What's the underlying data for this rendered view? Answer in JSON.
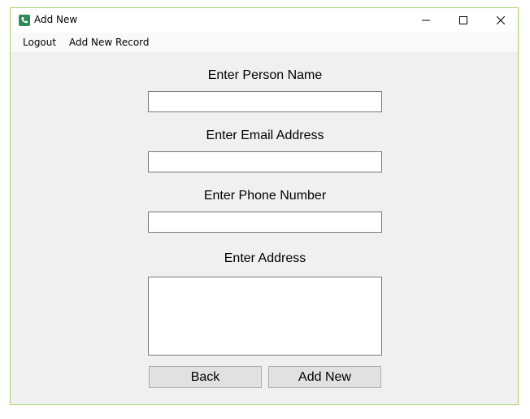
{
  "window": {
    "title": "Add New",
    "border_color": "#a6cf68",
    "icon": "phone-app-icon"
  },
  "title_controls": {
    "minimize_icon": "minimize-icon",
    "maximize_icon": "maximize-icon",
    "close_icon": "close-icon"
  },
  "menu": {
    "items": [
      {
        "label": "Logout"
      },
      {
        "label": "Add New Record"
      }
    ]
  },
  "form": {
    "name_label": "Enter Person Name",
    "name_value": "",
    "email_label": "Enter Email Address",
    "email_value": "",
    "phone_label": "Enter Phone Number",
    "phone_value": "",
    "address_label": "Enter Address",
    "address_value": ""
  },
  "buttons": {
    "back_label": "Back",
    "add_new_label": "Add New"
  }
}
